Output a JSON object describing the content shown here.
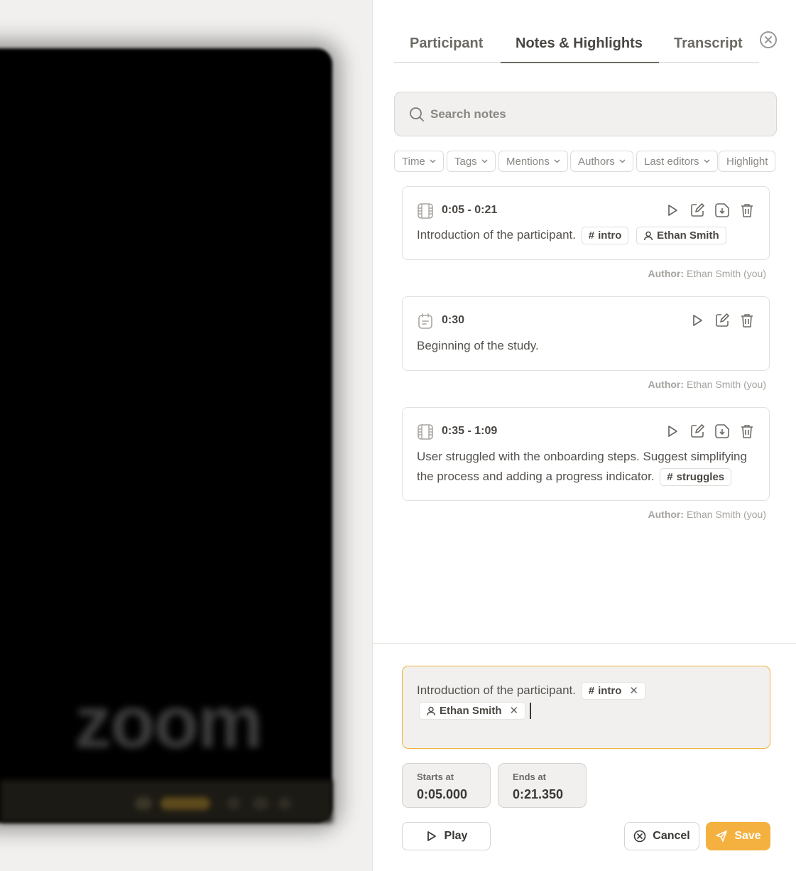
{
  "video": {
    "logo_text": "zoom"
  },
  "tabs": [
    {
      "label": "Participant",
      "active": false
    },
    {
      "label": "Notes & Highlights",
      "active": true
    },
    {
      "label": "Transcript",
      "active": false
    }
  ],
  "search": {
    "placeholder": "Search notes",
    "value": ""
  },
  "filters": [
    "Time",
    "Tags",
    "Mentions",
    "Authors",
    "Last editors",
    "Highlight"
  ],
  "notes": [
    {
      "type": "highlight",
      "time": "0:05 - 0:21",
      "text": "Introduction of the participant.",
      "tag": "intro",
      "mention": "Ethan Smith",
      "author_label": "Author:",
      "author": "Ethan Smith (you)"
    },
    {
      "type": "note",
      "time": "0:30",
      "text": "Beginning of the study.",
      "author_label": "Author:",
      "author": "Ethan Smith (you)"
    },
    {
      "type": "highlight",
      "time": "0:35 - 1:09",
      "text": "User struggled with the onboarding steps. Suggest simplifying the process and adding a progress indicator.",
      "tag": "struggles",
      "author_label": "Author:",
      "author": "Ethan Smith (you)"
    }
  ],
  "editor": {
    "text": "Introduction of the participant.",
    "tag": "intro",
    "mention": "Ethan Smith",
    "starts_label": "Starts at",
    "starts_value": "0:05.000",
    "ends_label": "Ends at",
    "ends_value": "0:21.350",
    "play_label": "Play",
    "cancel_label": "Cancel",
    "save_label": "Save"
  },
  "colors": {
    "accent": "#f5b13f",
    "editor_border": "#f2b43c"
  }
}
